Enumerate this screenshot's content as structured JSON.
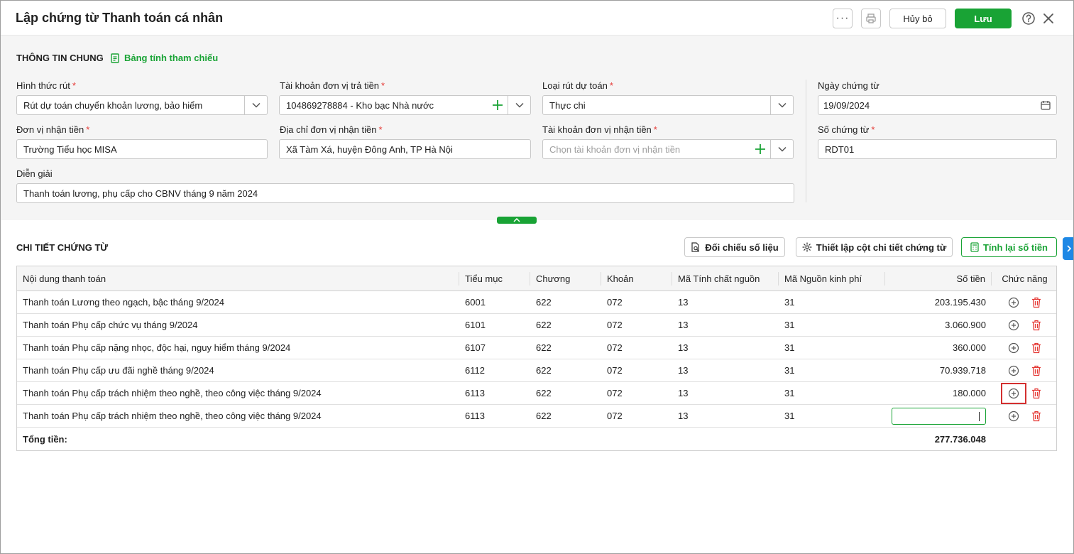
{
  "header": {
    "title": "Lập chứng từ Thanh toán cá nhân",
    "more_label": "···",
    "cancel_label": "Hủy bỏ",
    "save_label": "Lưu"
  },
  "general": {
    "section_title": "THÔNG TIN CHUNG",
    "ref_link": "Bảng tính tham chiếu",
    "fields": {
      "withdraw_form": {
        "label": "Hình thức rút",
        "value": "Rút dự toán chuyển khoản lương, bảo hiểm"
      },
      "payer_account": {
        "label": "Tài khoản đơn vị trả tiền",
        "value": "104869278884 - Kho bạc Nhà nước"
      },
      "estimate_type": {
        "label": "Loại rút dự toán",
        "value": "Thực chi"
      },
      "doc_date": {
        "label": "Ngày chứng từ",
        "value": "19/09/2024"
      },
      "payee_unit": {
        "label": "Đơn vị nhận tiền",
        "value": "Trường Tiểu học MISA"
      },
      "payee_address": {
        "label": "Địa chỉ đơn vị nhận tiền",
        "value": "Xã Tàm Xá, huyện Đông Anh, TP Hà Nội"
      },
      "payee_account": {
        "label": "Tài khoản đơn vị nhận tiền",
        "placeholder": "Chọn tài khoản đơn vị nhận tiền"
      },
      "doc_number": {
        "label": "Số chứng từ",
        "value": "RDT01"
      },
      "description": {
        "label": "Diễn giải",
        "value": "Thanh toán lương, phụ cấp cho CBNV tháng 9 năm 2024"
      }
    },
    "required_mark": "*"
  },
  "detail": {
    "section_title": "CHI TIẾT CHỨNG TỪ",
    "buttons": {
      "reconcile": "Đối chiếu số liệu",
      "columns": "Thiết lập cột chi tiết chứng từ",
      "recalc": "Tính lại số tiền"
    },
    "columns": [
      "Nội dung thanh toán",
      "Tiểu mục",
      "Chương",
      "Khoản",
      "Mã Tính chất nguồn",
      "Mã Nguồn kinh phí",
      "Số tiền",
      "Chức năng"
    ],
    "rows": [
      [
        "Thanh toán Lương theo ngạch, bậc tháng 9/2024",
        "6001",
        "622",
        "072",
        "13",
        "31",
        "203.195.430"
      ],
      [
        "Thanh toán Phụ cấp chức vụ tháng 9/2024",
        "6101",
        "622",
        "072",
        "13",
        "31",
        "3.060.900"
      ],
      [
        "Thanh toán Phụ cấp nặng nhọc, độc hại, nguy hiểm tháng 9/2024",
        "6107",
        "622",
        "072",
        "13",
        "31",
        "360.000"
      ],
      [
        "Thanh toán Phụ cấp ưu đãi nghề tháng 9/2024",
        "6112",
        "622",
        "072",
        "13",
        "31",
        "70.939.718"
      ],
      [
        "Thanh toán Phụ cấp trách nhiệm theo nghề, theo công việc tháng 9/2024",
        "6113",
        "622",
        "072",
        "13",
        "31",
        "180.000"
      ],
      [
        "Thanh toán Phụ cấp trách nhiệm theo nghề, theo công việc tháng 9/2024",
        "6113",
        "622",
        "072",
        "13",
        "31",
        ""
      ]
    ],
    "total_label": "Tổng tiền:",
    "total_value": "277.736.048"
  },
  "icons": {
    "add_row": "plus-circle-icon",
    "delete_row": "trash-icon",
    "help": "question-circle-icon",
    "close": "close-icon"
  },
  "colors": {
    "accent": "#19a335",
    "danger": "#e53935",
    "side_tab": "#1e88e5"
  }
}
